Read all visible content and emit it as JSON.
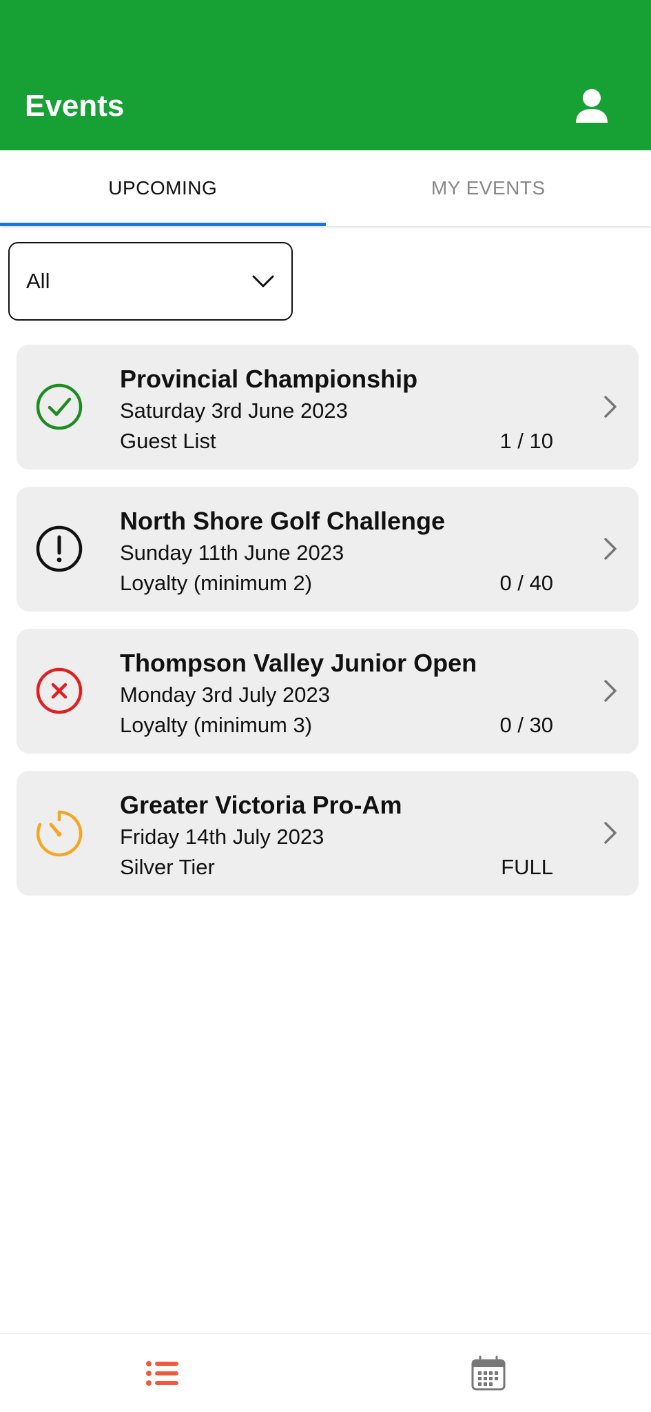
{
  "header": {
    "title": "Events"
  },
  "tabs": [
    {
      "label": "UPCOMING",
      "active": true
    },
    {
      "label": "MY EVENTS",
      "active": false
    }
  ],
  "filter": {
    "value": "All"
  },
  "events": [
    {
      "title": "Provincial Championship",
      "date": "Saturday 3rd June 2023",
      "tier": "Guest List",
      "count": "1 / 10",
      "status_icon": "check-circle-icon",
      "status_color": "#1e8c22"
    },
    {
      "title": "North Shore Golf Challenge",
      "date": "Sunday 11th June 2023",
      "tier": "Loyalty (minimum 2)",
      "count": "0 / 40",
      "status_icon": "exclamation-circle-icon",
      "status_color": "#111111"
    },
    {
      "title": "Thompson Valley Junior Open",
      "date": "Monday 3rd July 2023",
      "tier": "Loyalty (minimum 3)",
      "count": "0 / 30",
      "status_icon": "x-circle-icon",
      "status_color": "#e02020"
    },
    {
      "title": "Greater Victoria Pro-Am",
      "date": "Friday 14th July 2023",
      "tier": "Silver Tier",
      "count": "FULL",
      "status_icon": "timer-icon",
      "status_color": "#f5a623"
    }
  ],
  "bottom_nav": [
    {
      "icon": "list-icon",
      "active": true,
      "color": "#f05a3c"
    },
    {
      "icon": "calendar-icon",
      "active": false,
      "color": "#777777"
    }
  ],
  "colors": {
    "header": "#17a134",
    "tab_indicator": "#1a73e8",
    "card_bg": "#eeeeee"
  }
}
